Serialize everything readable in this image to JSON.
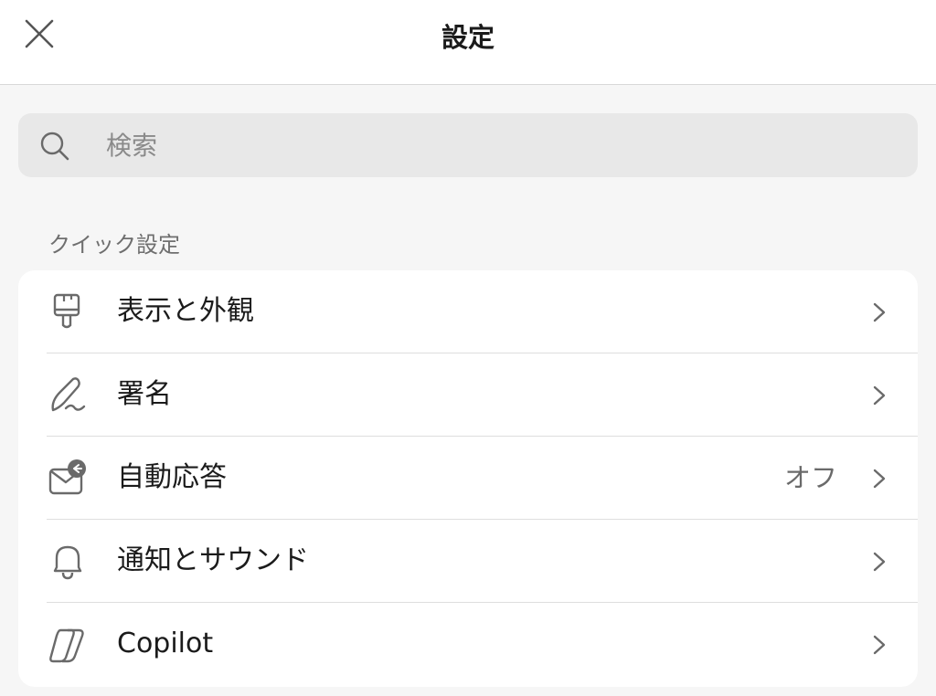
{
  "header": {
    "title": "設定",
    "close_icon": "close-icon"
  },
  "search": {
    "placeholder": "検索",
    "icon": "search-icon"
  },
  "quick_settings": {
    "header": "クイック設定",
    "items": [
      {
        "label": "表示と外観",
        "icon": "paintbrush-icon",
        "value": ""
      },
      {
        "label": "署名",
        "icon": "signature-icon",
        "value": ""
      },
      {
        "label": "自動応答",
        "icon": "mail-reply-icon",
        "value": "オフ"
      },
      {
        "label": "通知とサウンド",
        "icon": "bell-icon",
        "value": ""
      },
      {
        "label": "Copilot",
        "icon": "copilot-icon",
        "value": ""
      }
    ]
  },
  "colors": {
    "background": "#f6f6f6",
    "card": "#ffffff",
    "search_bg": "#e8e8e8",
    "text_primary": "#1b1b1b",
    "text_secondary": "#6f6f6f"
  }
}
